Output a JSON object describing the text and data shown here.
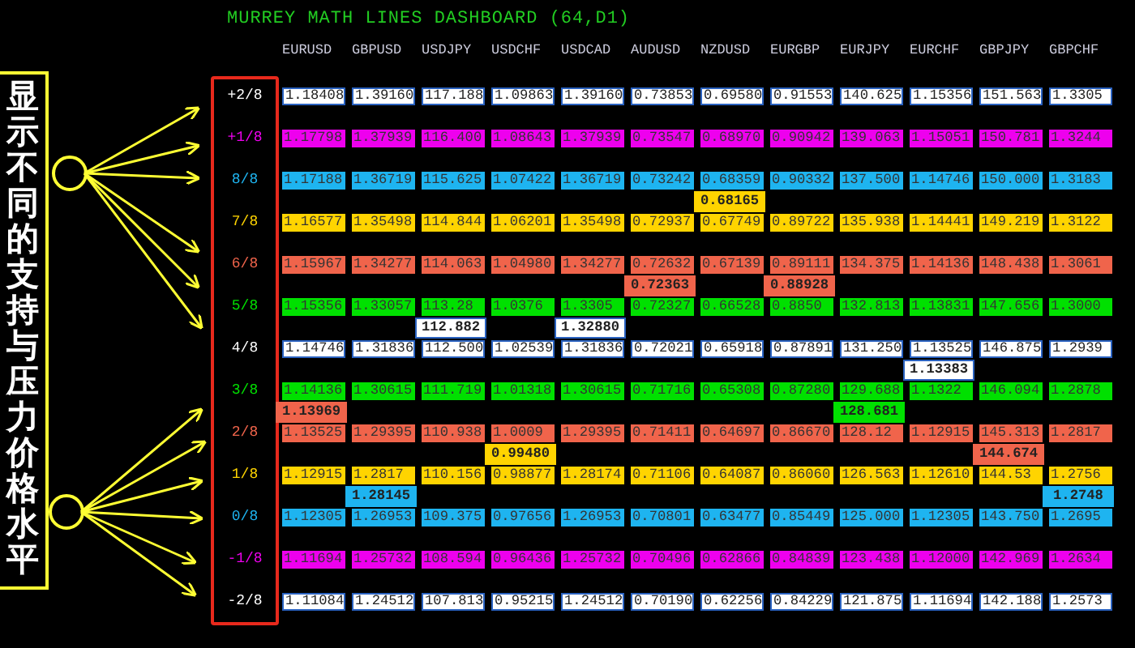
{
  "title": "MURREY MATH LINES DASHBOARD (64,D1)",
  "annotation": {
    "text": "显示不同的支持与压力价格水平"
  },
  "levels": [
    {
      "label": "+2/8",
      "color": "#ffffff"
    },
    {
      "label": "+1/8",
      "color": "#ee00ee"
    },
    {
      "label": "8/8",
      "color": "#1eb4f0"
    },
    {
      "label": "7/8",
      "color": "#ffd400"
    },
    {
      "label": "6/8",
      "color": "#f0644b"
    },
    {
      "label": "5/8",
      "color": "#00e000"
    },
    {
      "label": "4/8",
      "color": "#ffffff"
    },
    {
      "label": "3/8",
      "color": "#00e000"
    },
    {
      "label": "2/8",
      "color": "#f0644b"
    },
    {
      "label": "1/8",
      "color": "#ffd400"
    },
    {
      "label": "0/8",
      "color": "#1eb4f0"
    },
    {
      "label": "-1/8",
      "color": "#ee00ee"
    },
    {
      "label": "-2/8",
      "color": "#ffffff"
    }
  ],
  "columns": [
    {
      "symbol": "EURUSD",
      "cells": [
        {
          "value": "1.18408"
        },
        {
          "value": "1.17798"
        },
        {
          "value": "1.17188"
        },
        {
          "value": "1.16577"
        },
        {
          "value": "1.15967"
        },
        {
          "value": "1.15356"
        },
        {
          "value": "1.14746"
        },
        {
          "value": "1.14136",
          "price_below": {
            "value": "1.13969",
            "color": "#f0644b"
          }
        },
        {
          "value": "1.13525"
        },
        {
          "value": "1.12915"
        },
        {
          "value": "1.12305"
        },
        {
          "value": "1.11694"
        },
        {
          "value": "1.11084"
        }
      ]
    },
    {
      "symbol": "GBPUSD",
      "cells": [
        {
          "value": "1.39160"
        },
        {
          "value": "1.37939"
        },
        {
          "value": "1.36719"
        },
        {
          "value": "1.35498"
        },
        {
          "value": "1.34277"
        },
        {
          "value": "1.33057"
        },
        {
          "value": "1.31836"
        },
        {
          "value": "1.30615"
        },
        {
          "value": "1.29395"
        },
        {
          "value": "1.2817",
          "price_below": {
            "value": "1.28145",
            "color": "#1eb4f0"
          }
        },
        {
          "value": "1.26953"
        },
        {
          "value": "1.25732"
        },
        {
          "value": "1.24512"
        }
      ]
    },
    {
      "symbol": "USDJPY",
      "cells": [
        {
          "value": "117.188"
        },
        {
          "value": "116.400"
        },
        {
          "value": "115.625"
        },
        {
          "value": "114.844"
        },
        {
          "value": "114.063"
        },
        {
          "value": "113.28",
          "price_below": {
            "value": "112.882",
            "color": "#ffffff"
          }
        },
        {
          "value": "112.500"
        },
        {
          "value": "111.719"
        },
        {
          "value": "110.938"
        },
        {
          "value": "110.156"
        },
        {
          "value": "109.375"
        },
        {
          "value": "108.594"
        },
        {
          "value": "107.813"
        }
      ]
    },
    {
      "symbol": "USDCHF",
      "cells": [
        {
          "value": "1.09863"
        },
        {
          "value": "1.08643"
        },
        {
          "value": "1.07422"
        },
        {
          "value": "1.06201"
        },
        {
          "value": "1.04980"
        },
        {
          "value": "1.0376"
        },
        {
          "value": "1.02539"
        },
        {
          "value": "1.01318"
        },
        {
          "value": "1.0009",
          "price_below": {
            "value": "0.99480",
            "color": "#ffd400"
          }
        },
        {
          "value": "0.98877"
        },
        {
          "value": "0.97656"
        },
        {
          "value": "0.96436"
        },
        {
          "value": "0.95215"
        }
      ]
    },
    {
      "symbol": "USDCAD",
      "cells": [
        {
          "value": "1.39160"
        },
        {
          "value": "1.37939"
        },
        {
          "value": "1.36719"
        },
        {
          "value": "1.35498"
        },
        {
          "value": "1.34277"
        },
        {
          "value": "1.3305",
          "price_below": {
            "value": "1.32880",
            "color": "#ffffff"
          }
        },
        {
          "value": "1.31836"
        },
        {
          "value": "1.30615"
        },
        {
          "value": "1.29395"
        },
        {
          "value": "1.28174"
        },
        {
          "value": "1.26953"
        },
        {
          "value": "1.25732"
        },
        {
          "value": "1.24512"
        }
      ]
    },
    {
      "symbol": "AUDUSD",
      "cells": [
        {
          "value": "0.73853"
        },
        {
          "value": "0.73547"
        },
        {
          "value": "0.73242"
        },
        {
          "value": "0.72937"
        },
        {
          "value": "0.72632",
          "price_below": {
            "value": "0.72363",
            "color": "#f0644b"
          }
        },
        {
          "value": "0.72327"
        },
        {
          "value": "0.72021"
        },
        {
          "value": "0.71716"
        },
        {
          "value": "0.71411"
        },
        {
          "value": "0.71106"
        },
        {
          "value": "0.70801"
        },
        {
          "value": "0.70496"
        },
        {
          "value": "0.70190"
        }
      ]
    },
    {
      "symbol": "NZDUSD",
      "cells": [
        {
          "value": "0.69580"
        },
        {
          "value": "0.68970"
        },
        {
          "value": "0.68359",
          "price_below": {
            "value": "0.68165",
            "color": "#ffd400"
          }
        },
        {
          "value": "0.67749"
        },
        {
          "value": "0.67139"
        },
        {
          "value": "0.66528"
        },
        {
          "value": "0.65918"
        },
        {
          "value": "0.65308"
        },
        {
          "value": "0.64697"
        },
        {
          "value": "0.64087"
        },
        {
          "value": "0.63477"
        },
        {
          "value": "0.62866"
        },
        {
          "value": "0.62256"
        }
      ]
    },
    {
      "symbol": "EURGBP",
      "cells": [
        {
          "value": "0.91553"
        },
        {
          "value": "0.90942"
        },
        {
          "value": "0.90332"
        },
        {
          "value": "0.89722"
        },
        {
          "value": "0.89111",
          "price_below": {
            "value": "0.88928",
            "color": "#f0644b"
          }
        },
        {
          "value": "0.8850"
        },
        {
          "value": "0.87891"
        },
        {
          "value": "0.87280"
        },
        {
          "value": "0.86670"
        },
        {
          "value": "0.86060"
        },
        {
          "value": "0.85449"
        },
        {
          "value": "0.84839"
        },
        {
          "value": "0.84229"
        }
      ]
    },
    {
      "symbol": "EURJPY",
      "cells": [
        {
          "value": "140.625"
        },
        {
          "value": "139.063"
        },
        {
          "value": "137.500"
        },
        {
          "value": "135.938"
        },
        {
          "value": "134.375"
        },
        {
          "value": "132.813"
        },
        {
          "value": "131.250"
        },
        {
          "value": "129.688",
          "price_below": {
            "value": "128.681",
            "color": "#00e000"
          }
        },
        {
          "value": "128.12"
        },
        {
          "value": "126.563"
        },
        {
          "value": "125.000"
        },
        {
          "value": "123.438"
        },
        {
          "value": "121.875"
        }
      ]
    },
    {
      "symbol": "EURCHF",
      "cells": [
        {
          "value": "1.15356"
        },
        {
          "value": "1.15051"
        },
        {
          "value": "1.14746"
        },
        {
          "value": "1.14441"
        },
        {
          "value": "1.14136"
        },
        {
          "value": "1.13831"
        },
        {
          "value": "1.13525",
          "price_below": {
            "value": "1.13383",
            "color": "#ffffff"
          }
        },
        {
          "value": "1.1322"
        },
        {
          "value": "1.12915"
        },
        {
          "value": "1.12610"
        },
        {
          "value": "1.12305"
        },
        {
          "value": "1.12000"
        },
        {
          "value": "1.11694"
        }
      ]
    },
    {
      "symbol": "GBPJPY",
      "cells": [
        {
          "value": "151.563"
        },
        {
          "value": "150.781"
        },
        {
          "value": "150.000"
        },
        {
          "value": "149.219"
        },
        {
          "value": "148.438"
        },
        {
          "value": "147.656"
        },
        {
          "value": "146.875"
        },
        {
          "value": "146.094"
        },
        {
          "value": "145.313",
          "price_below": {
            "value": "144.674",
            "color": "#f0644b"
          }
        },
        {
          "value": "144.53"
        },
        {
          "value": "143.750"
        },
        {
          "value": "142.969"
        },
        {
          "value": "142.188"
        }
      ]
    },
    {
      "symbol": "GBPCHF",
      "cells": [
        {
          "value": "1.3305"
        },
        {
          "value": "1.3244"
        },
        {
          "value": "1.3183"
        },
        {
          "value": "1.3122"
        },
        {
          "value": "1.3061"
        },
        {
          "value": "1.3000"
        },
        {
          "value": "1.2939"
        },
        {
          "value": "1.2878"
        },
        {
          "value": "1.2817"
        },
        {
          "value": "1.2756",
          "price_below": {
            "value": "1.2748",
            "color": "#1eb4f0"
          }
        },
        {
          "value": "1.2695"
        },
        {
          "value": "1.2634"
        },
        {
          "value": "1.2573"
        }
      ]
    }
  ]
}
